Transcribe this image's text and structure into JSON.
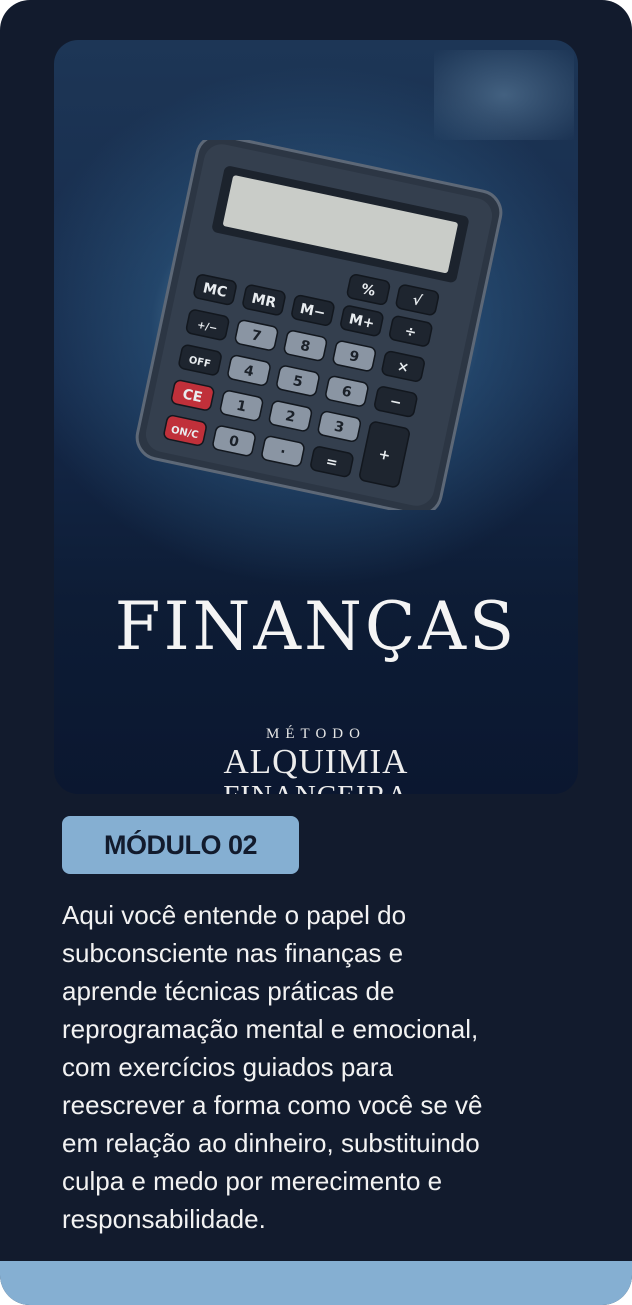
{
  "cover": {
    "title": "FINANÇAS",
    "brand": {
      "top": "MÉTODO",
      "line1": "ALQUIMIA",
      "line2": "FINANCEIRA"
    },
    "calculator_keys": {
      "row0": [
        "%",
        "√"
      ],
      "row1": [
        "MC",
        "MR",
        "M−",
        "M+",
        "÷"
      ],
      "row2": [
        "+/−",
        "7",
        "8",
        "9",
        "×"
      ],
      "row3": [
        "OFF",
        "4",
        "5",
        "6",
        "−"
      ],
      "row4": [
        "CE",
        "1",
        "2",
        "3",
        "+"
      ],
      "row5": [
        "ON/C",
        "0",
        "·",
        "="
      ]
    }
  },
  "module": {
    "badge": "MÓDULO 02",
    "description": "Aqui você entende o papel do\nsubconsciente nas finanças e\naprende técnicas práticas de\nreprogramação mental e emocional,\ncom exercícios guiados para\nreescrever a forma como você se vê\nem relação ao dinheiro, substituindo\nculpa e medo por merecimento e\nresponsabilidade."
  },
  "colors": {
    "card_background": "#121b2d",
    "accent": "#85afd2",
    "text": "#f2f2f2",
    "calculator_red_key": "#c0303a"
  }
}
